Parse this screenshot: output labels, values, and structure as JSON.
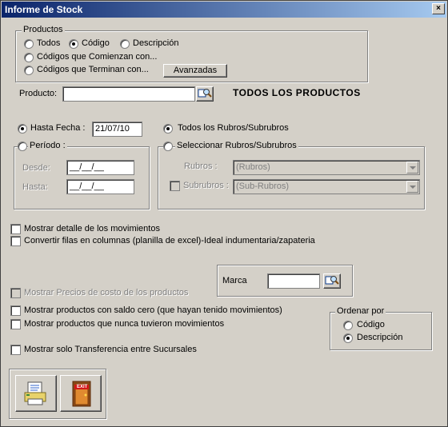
{
  "window": {
    "title": "Informe de Stock",
    "close_glyph": "×"
  },
  "productos": {
    "legend": "Productos",
    "opt_todos": "Todos",
    "opt_codigo": "Código",
    "opt_descripcion": "Descripción",
    "opt_comienzan": "Códigos que Comienzan con...",
    "opt_terminan": "Códigos que Terminan con...",
    "avanzadas_label": "Avanzadas",
    "producto_label": "Producto:",
    "producto_value": "",
    "search_icon": "search-icon",
    "todos_productos": "TODOS LOS PRODUCTOS"
  },
  "fechas": {
    "hasta_fecha_label": "Hasta Fecha :",
    "hasta_fecha_value": "21/07/10",
    "periodo_label": "Período :",
    "desde_label": "Desde:",
    "desde_value": "__/__/__",
    "hasta_label": "Hasta:",
    "hasta_value": "__/__/__"
  },
  "rubros": {
    "todos_label": "Todos los Rubros/Subrubros",
    "seleccionar_label": "Seleccionar Rubros/Subrubros",
    "rubros_label": "Rubros :",
    "rubros_value": "(Rubros)",
    "subrubros_label": "Subrubros :",
    "subrubros_value": "(Sub-Rubros)"
  },
  "options": {
    "mostrar_detalle": "Mostrar detalle de los movimientos",
    "convertir_filas": "Convertir filas en columnas (planilla de excel)-Ideal indumentaria/zapateria",
    "mostrar_precios": "Mostrar Precios de costo de los productos",
    "saldo_cero": "Mostrar productos con saldo cero (que hayan tenido movimientos)",
    "nunca_movimientos": "Mostrar productos que nunca tuvieron movimientos",
    "transferencia": "Mostrar solo Transferencia entre Sucursales"
  },
  "marca": {
    "label": "Marca",
    "value": ""
  },
  "ordenar": {
    "legend": "Ordenar por",
    "codigo": "Código",
    "descripcion": "Descripción"
  },
  "icons": {
    "print": "printer-report-icon",
    "exit": "exit-door-icon",
    "exit_text": "EXIT"
  },
  "colors": {
    "title_start": "#0a246a",
    "title_end": "#a6caf0",
    "face": "#d4d0c8"
  }
}
